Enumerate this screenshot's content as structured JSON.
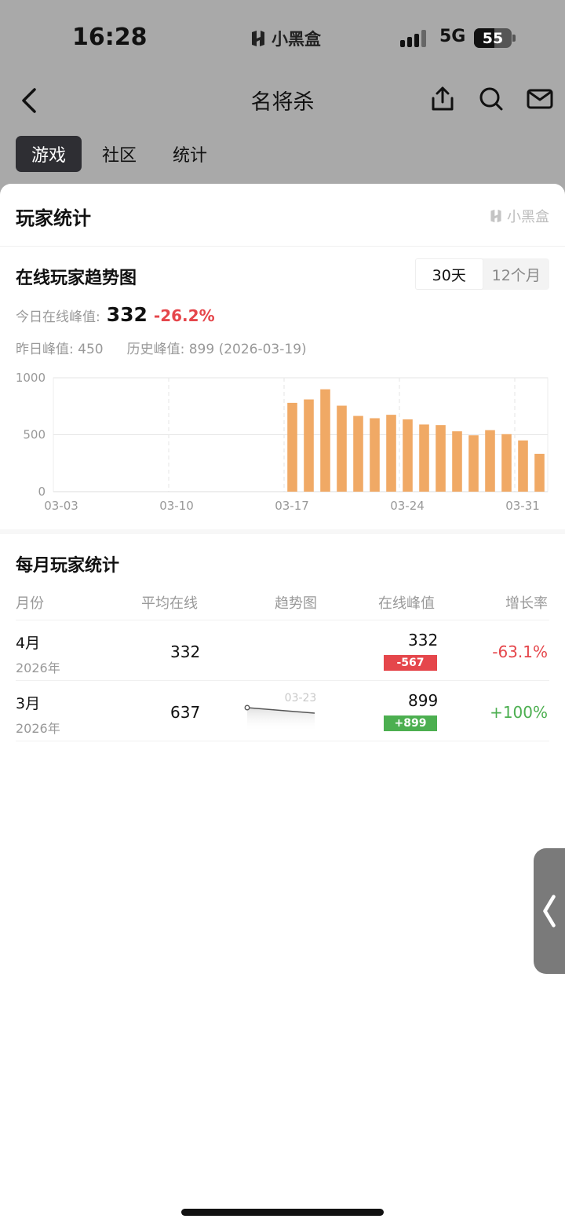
{
  "status": {
    "time": "16:28",
    "carrier": "小黑盒",
    "network": "5G",
    "battery": "55",
    "battery_level": 0.55
  },
  "nav": {
    "title": "名将杀",
    "icons": [
      "back-icon",
      "share-icon",
      "search-icon",
      "mail-icon"
    ]
  },
  "tabs": [
    {
      "label": "游戏",
      "active": true
    },
    {
      "label": "社区",
      "active": false
    },
    {
      "label": "统计",
      "active": false
    }
  ],
  "sheet": {
    "title": "玩家统计",
    "brand": "小黑盒"
  },
  "trend": {
    "title": "在线玩家趋势图",
    "ranges": [
      {
        "label": "30天",
        "active": true
      },
      {
        "label": "12个月",
        "active": false
      }
    ],
    "today_label": "今日在线峰值:",
    "today_value": "332",
    "today_change": "-26.2%",
    "yesterday_peak": "昨日峰值: 450",
    "history_peak": "历史峰值: 899 (2026-03-19)"
  },
  "chart_data": {
    "type": "bar",
    "x": [
      "03-03",
      "03-04",
      "03-05",
      "03-06",
      "03-07",
      "03-08",
      "03-09",
      "03-10",
      "03-11",
      "03-12",
      "03-13",
      "03-14",
      "03-15",
      "03-16",
      "03-17",
      "03-18",
      "03-19",
      "03-20",
      "03-21",
      "03-22",
      "03-23",
      "03-24",
      "03-25",
      "03-26",
      "03-27",
      "03-28",
      "03-29",
      "03-30",
      "03-31",
      "04-01"
    ],
    "values": [
      0,
      0,
      0,
      0,
      0,
      0,
      0,
      0,
      0,
      0,
      0,
      0,
      0,
      0,
      780,
      810,
      899,
      755,
      665,
      645,
      675,
      635,
      590,
      585,
      530,
      495,
      540,
      505,
      450,
      332
    ],
    "xticks": [
      "03-03",
      "03-10",
      "03-17",
      "03-24",
      "03-31"
    ],
    "yticks": [
      "0",
      "500",
      "1000"
    ],
    "ylim": [
      0,
      1000
    ],
    "color": "#f0a965"
  },
  "monthly": {
    "title": "每月玩家统计",
    "headers": [
      "月份",
      "平均在线",
      "趋势图",
      "在线峰值",
      "增长率"
    ],
    "rows": [
      {
        "month": "4月",
        "year": "2026年",
        "avg": "332",
        "peak": "332",
        "delta": "-567",
        "delta_sign": "neg",
        "rate": "-63.1%",
        "rate_sign": "neg",
        "spark_label": ""
      },
      {
        "month": "3月",
        "year": "2026年",
        "avg": "637",
        "peak": "899",
        "delta": "+899",
        "delta_sign": "pos",
        "rate": "+100%",
        "rate_sign": "pos",
        "spark_label": "03-23"
      }
    ]
  }
}
